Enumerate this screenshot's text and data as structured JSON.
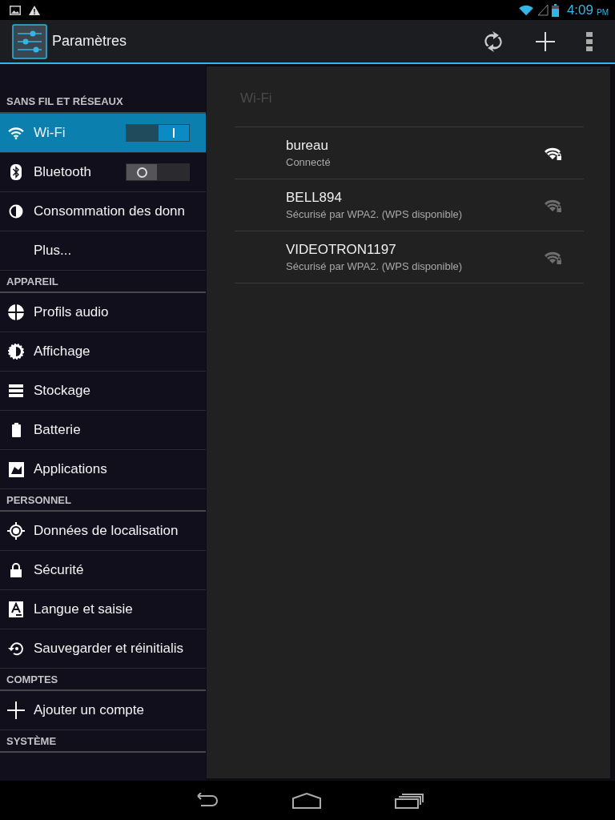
{
  "status_bar": {
    "time": "4:09",
    "ampm": "PM"
  },
  "action_bar": {
    "title": "Paramètres"
  },
  "sidebar": {
    "sections": [
      {
        "title": "SANS FIL ET RÉSEAUX",
        "items": [
          {
            "label": "Wi-Fi",
            "kind": "toggle",
            "on": true,
            "selected": true
          },
          {
            "label": "Bluetooth",
            "kind": "toggle",
            "on": false,
            "selected": false
          },
          {
            "label": "Consommation des donn",
            "kind": "link",
            "selected": false
          },
          {
            "label": "Plus...",
            "kind": "link",
            "selected": false
          }
        ]
      },
      {
        "title": "APPAREIL",
        "items": [
          {
            "label": "Profils audio",
            "kind": "link",
            "selected": false
          },
          {
            "label": "Affichage",
            "kind": "link",
            "selected": false
          },
          {
            "label": "Stockage",
            "kind": "link",
            "selected": false
          },
          {
            "label": "Batterie",
            "kind": "link",
            "selected": false
          },
          {
            "label": "Applications",
            "kind": "link",
            "selected": false
          }
        ]
      },
      {
        "title": "PERSONNEL",
        "items": [
          {
            "label": "Données de localisation",
            "kind": "link",
            "selected": false
          },
          {
            "label": "Sécurité",
            "kind": "link",
            "selected": false
          },
          {
            "label": "Langue et saisie",
            "kind": "link",
            "selected": false
          },
          {
            "label": "Sauvegarder et réinitialis",
            "kind": "link",
            "selected": false
          }
        ]
      },
      {
        "title": "COMPTES",
        "items": [
          {
            "label": "Ajouter un compte",
            "kind": "link",
            "selected": false
          }
        ]
      },
      {
        "title": "SYSTÈME"
      }
    ]
  },
  "detail": {
    "title": "Wi-Fi",
    "networks": [
      {
        "name": "bureau",
        "status": "Connecté",
        "connected": true
      },
      {
        "name": "BELL894",
        "status": "Sécurisé par WPA2. (WPS disponible)",
        "connected": false
      },
      {
        "name": "VIDEOTRON1197",
        "status": "Sécurisé par WPA2. (WPS disponible)",
        "connected": false
      }
    ]
  }
}
